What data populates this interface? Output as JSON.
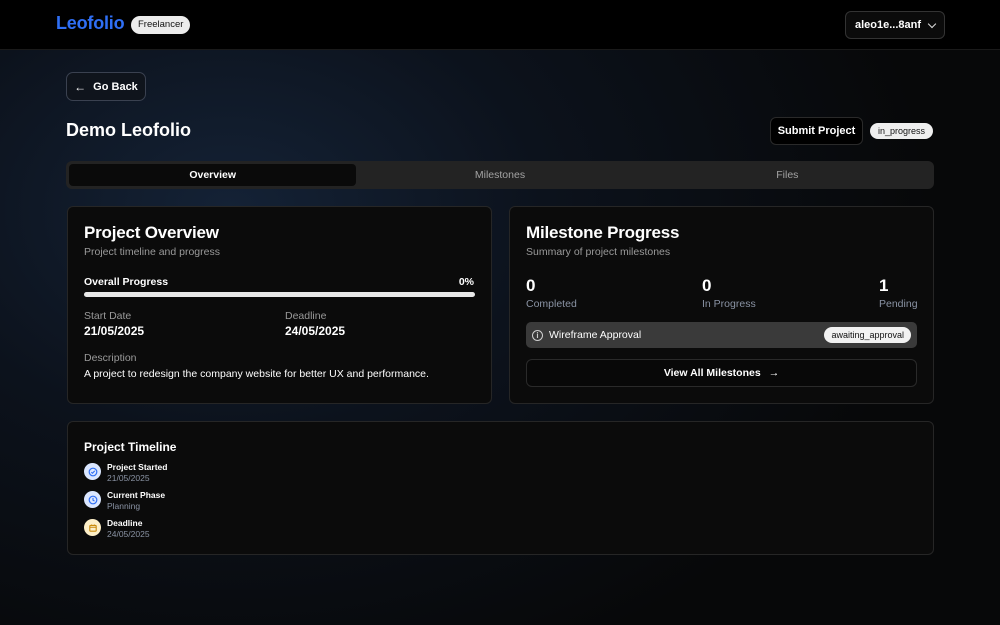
{
  "header": {
    "logo": "Leofolio",
    "role_badge": "Freelancer",
    "wallet": "aleo1e...8anf"
  },
  "nav": {
    "go_back": "Go Back"
  },
  "project": {
    "title": "Demo Leofolio",
    "submit_label": "Submit Project",
    "status": "in_progress"
  },
  "tabs": [
    {
      "label": "Overview",
      "active": true
    },
    {
      "label": "Milestones",
      "active": false
    },
    {
      "label": "Files",
      "active": false
    }
  ],
  "overview": {
    "title": "Project Overview",
    "subtitle": "Project timeline and progress",
    "progress_label": "Overall Progress",
    "progress_text": "0%",
    "progress_value": 0,
    "start_label": "Start Date",
    "start_value": "21/05/2025",
    "deadline_label": "Deadline",
    "deadline_value": "24/05/2025",
    "description_label": "Description",
    "description": "A project to redesign the company website for better UX and performance."
  },
  "milestones": {
    "title": "Milestone Progress",
    "subtitle": "Summary of project milestones",
    "stats": [
      {
        "value": "0",
        "label": "Completed"
      },
      {
        "value": "0",
        "label": "In Progress"
      },
      {
        "value": "1",
        "label": "Pending"
      }
    ],
    "items": [
      {
        "name": "Wireframe Approval",
        "status": "awaiting_approval"
      }
    ],
    "view_all": "View All Milestones"
  },
  "timeline": {
    "title": "Project Timeline",
    "items": [
      {
        "name": "Project Started",
        "value": "21/05/2025",
        "icon": "check-circle-icon"
      },
      {
        "name": "Current Phase",
        "value": "Planning",
        "icon": "clock-icon"
      },
      {
        "name": "Deadline",
        "value": "24/05/2025",
        "icon": "calendar-icon"
      }
    ]
  },
  "colors": {
    "accent": "#2f6ff5",
    "background": "#0c121c",
    "card": "#0b0b0b"
  }
}
